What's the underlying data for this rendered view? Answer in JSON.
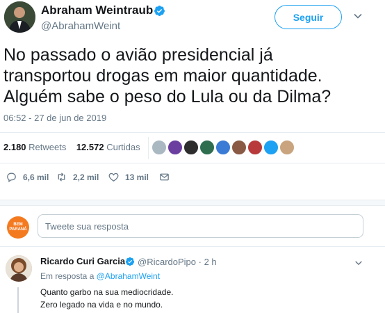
{
  "author": {
    "name": "Abraham Weintraub",
    "handle": "@AbrahamWeint",
    "follow_label": "Seguir"
  },
  "tweet": {
    "lines": [
      "No passado o avião presidencial já",
      "transportou drogas em maior quantidade.",
      "Alguém sabe o peso do Lula ou da Dilma?"
    ],
    "timestamp": "06:52 - 27 de jun de 2019"
  },
  "stats": {
    "retweets_count": "2.180",
    "retweets_label": "Retweets",
    "likes_count": "12.572",
    "likes_label": "Curtidas"
  },
  "likers": [
    {
      "icon": "avatar-gray",
      "color": "#aab8c2"
    },
    {
      "icon": "avatar-purple",
      "color": "#6b3fa0"
    },
    {
      "icon": "avatar-dark",
      "color": "#2d2d2d"
    },
    {
      "icon": "avatar-green",
      "color": "#2f6e4f"
    },
    {
      "icon": "avatar-blue",
      "color": "#3a7bd5"
    },
    {
      "icon": "avatar-brown",
      "color": "#8a5a44"
    },
    {
      "icon": "avatar-red",
      "color": "#b83a3a"
    },
    {
      "icon": "avatar-skyblue",
      "color": "#1da1f2"
    },
    {
      "icon": "avatar-tan",
      "color": "#c9a47e"
    }
  ],
  "actions": {
    "replies": "6,6 mil",
    "retweets": "2,2 mil",
    "likes": "13 mil"
  },
  "reply_box": {
    "avatar_text_1": "BEM",
    "avatar_text_2": "PARANÁ",
    "placeholder": "Tweete sua resposta"
  },
  "reply": {
    "name": "Ricardo Curi Garcia",
    "handle": "@RicardoPipo · 2 h",
    "in_reply_prefix": "Em resposta a",
    "in_reply_handle": "@AbrahamWeint",
    "line1": "Quanto garbo na sua mediocridade.",
    "line2": "Zero legado na vida e no mundo."
  },
  "colors": {
    "accent": "#1da1f2",
    "secondary_text": "#657786",
    "brand_orange": "#f47a20"
  }
}
